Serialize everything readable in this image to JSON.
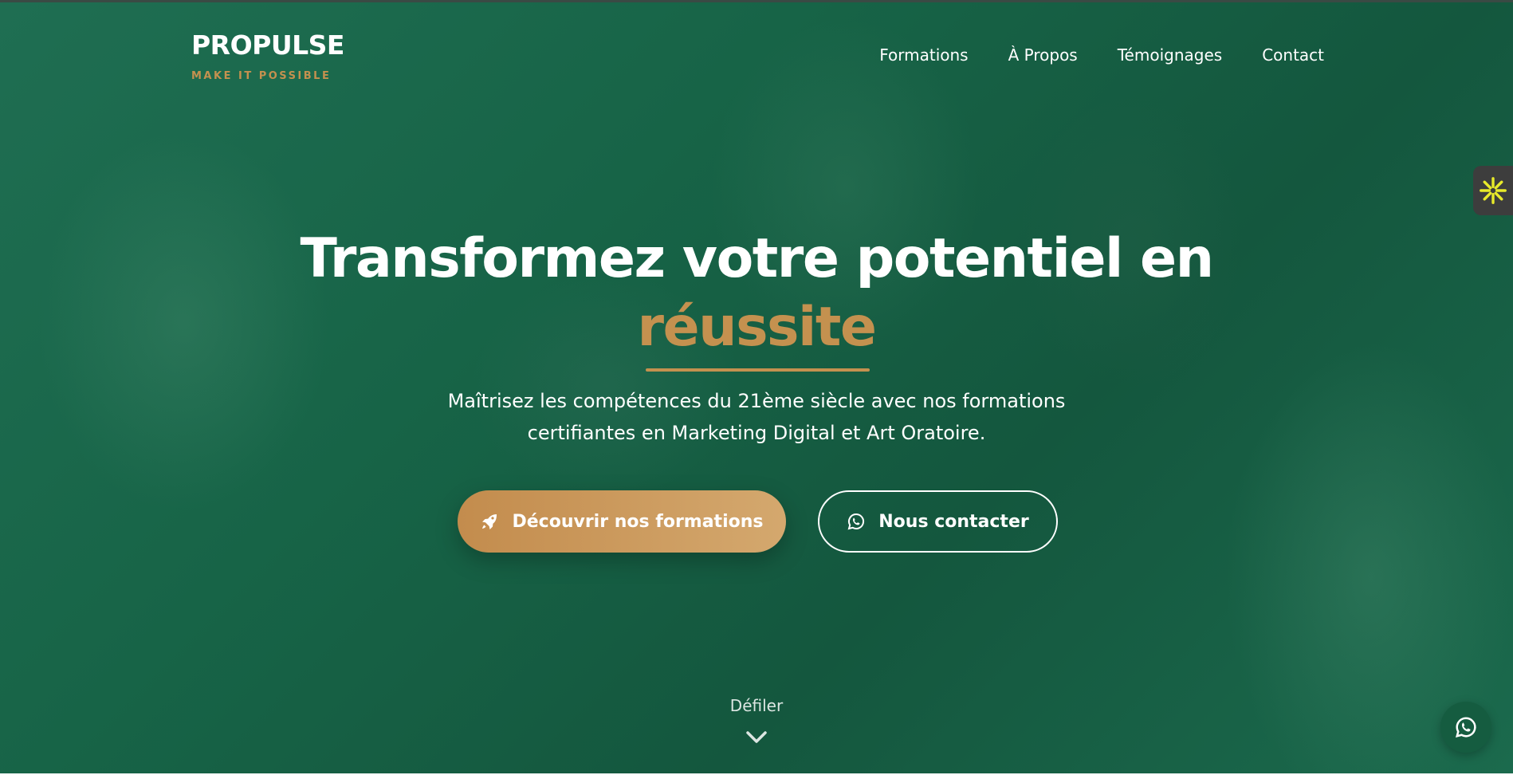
{
  "brand": {
    "name": "PROPULSE",
    "tagline": "MAKE IT POSSIBLE",
    "accent_color": "#c4914f",
    "primary_color": "#176447"
  },
  "nav": {
    "items": [
      {
        "label": "Formations"
      },
      {
        "label": "À Propos"
      },
      {
        "label": "Témoignages"
      },
      {
        "label": "Contact"
      }
    ]
  },
  "hero": {
    "headline_line1": "Transformez votre potentiel en",
    "headline_highlight": "réussite",
    "subtitle_line1": "Maîtrisez les compétences du 21ème siècle avec nos formations",
    "subtitle_line2": "certifiantes en Marketing Digital et Art Oratoire.",
    "primary_button": {
      "label": "Découvrir nos formations",
      "icon": "rocket-icon"
    },
    "secondary_button": {
      "label": "Nous contacter",
      "icon": "whatsapp-icon"
    },
    "scroll_label": "Défiler",
    "scroll_icon": "chevron-down-icon"
  },
  "side_widget": {
    "icon": "sparkle-icon",
    "icon_color": "#e8ea2a"
  },
  "floating_button": {
    "icon": "whatsapp-icon"
  }
}
